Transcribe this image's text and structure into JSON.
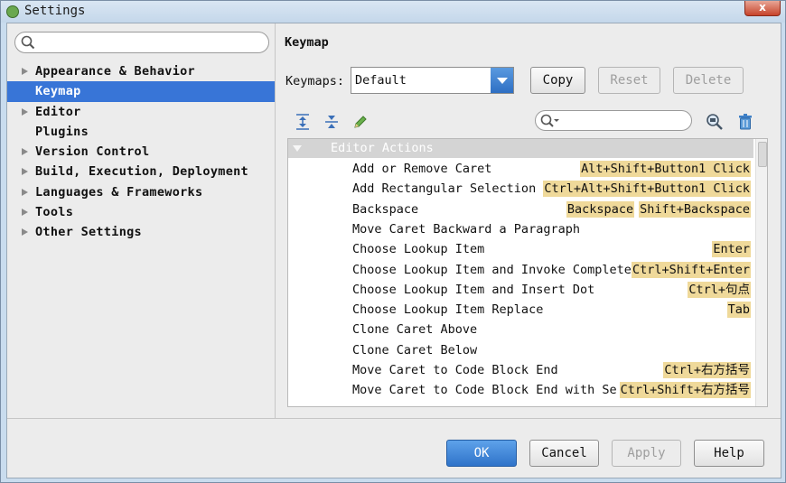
{
  "window": {
    "title": "Settings",
    "close_label": "x"
  },
  "sidebar": {
    "search_placeholder": "",
    "items": [
      {
        "label": "Appearance & Behavior",
        "expandable": true,
        "selected": false
      },
      {
        "label": "Keymap",
        "expandable": false,
        "selected": true
      },
      {
        "label": "Editor",
        "expandable": true,
        "selected": false
      },
      {
        "label": "Plugins",
        "expandable": false,
        "selected": false
      },
      {
        "label": "Version Control",
        "expandable": true,
        "selected": false
      },
      {
        "label": "Build, Execution, Deployment",
        "expandable": true,
        "selected": false
      },
      {
        "label": "Languages & Frameworks",
        "expandable": true,
        "selected": false
      },
      {
        "label": "Tools",
        "expandable": true,
        "selected": false
      },
      {
        "label": "Other Settings",
        "expandable": true,
        "selected": false
      }
    ]
  },
  "main": {
    "title": "Keymap",
    "keymaps_label": "Keymaps:",
    "keymap_value": "Default",
    "copy_label": "Copy",
    "reset_label": "Reset",
    "delete_label": "Delete",
    "filter_placeholder": "",
    "group_label": "Editor Actions",
    "actions": [
      {
        "name": "Add or Remove Caret",
        "shortcuts": [
          "Alt+Shift+Button1 Click"
        ]
      },
      {
        "name": "Add Rectangular Selection",
        "shortcuts": [
          "Ctrl+Alt+Shift+Button1 Click"
        ]
      },
      {
        "name": "Backspace",
        "shortcuts": [
          "Backspace",
          "Shift+Backspace"
        ]
      },
      {
        "name": "Move Caret Backward a Paragraph",
        "shortcuts": []
      },
      {
        "name": "Choose Lookup Item",
        "shortcuts": [
          "Enter"
        ]
      },
      {
        "name": "Choose Lookup Item and Invoke Complete",
        "shortcuts": [
          "Ctrl+Shift+Enter"
        ]
      },
      {
        "name": "Choose Lookup Item and Insert Dot",
        "shortcuts": [
          "Ctrl+句点"
        ]
      },
      {
        "name": "Choose Lookup Item Replace",
        "shortcuts": [
          "Tab"
        ]
      },
      {
        "name": "Clone Caret Above",
        "shortcuts": []
      },
      {
        "name": "Clone Caret Below",
        "shortcuts": []
      },
      {
        "name": "Move Caret to Code Block End",
        "shortcuts": [
          "Ctrl+右方括号"
        ]
      },
      {
        "name": "Move Caret to Code Block End with Se",
        "shortcuts": [
          "Ctrl+Shift+右方括号"
        ]
      }
    ]
  },
  "footer": {
    "ok_label": "OK",
    "cancel_label": "Cancel",
    "apply_label": "Apply",
    "help_label": "Help"
  },
  "colors": {
    "selection": "#3875d7",
    "shortcut_highlight": "#efd99a",
    "primary_button": "#3b7fd4"
  }
}
